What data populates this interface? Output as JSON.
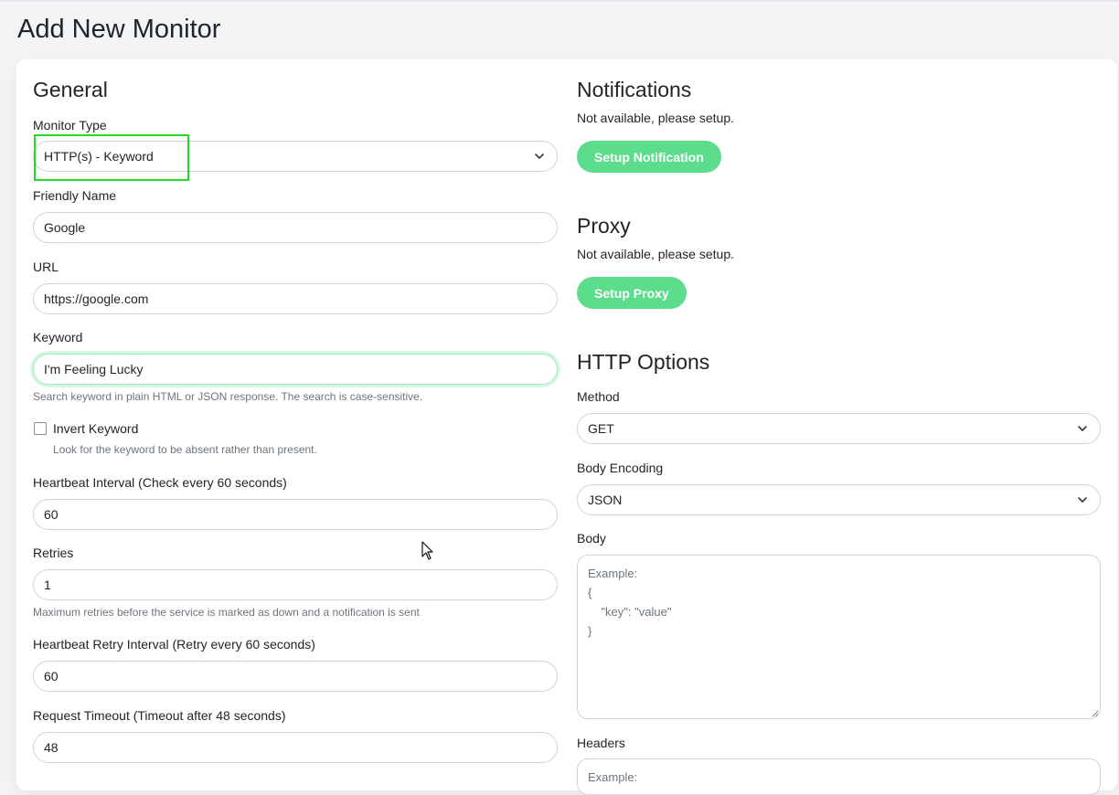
{
  "page": {
    "title": "Add New Monitor"
  },
  "general": {
    "heading": "General",
    "monitor_type": {
      "label": "Monitor Type",
      "value": "HTTP(s) - Keyword"
    },
    "friendly_name": {
      "label": "Friendly Name",
      "value": "Google"
    },
    "url": {
      "label": "URL",
      "value": "https://google.com"
    },
    "keyword": {
      "label": "Keyword",
      "value": "I'm Feeling Lucky",
      "help": "Search keyword in plain HTML or JSON response. The search is case-sensitive."
    },
    "invert_keyword": {
      "label": "Invert Keyword",
      "help": "Look for the keyword to be absent rather than present.",
      "checked": false
    },
    "heartbeat_interval": {
      "label": "Heartbeat Interval (Check every 60 seconds)",
      "value": "60"
    },
    "retries": {
      "label": "Retries",
      "value": "1",
      "help": "Maximum retries before the service is marked as down and a notification is sent"
    },
    "retry_interval": {
      "label": "Heartbeat Retry Interval (Retry every 60 seconds)",
      "value": "60"
    },
    "request_timeout": {
      "label": "Request Timeout (Timeout after 48 seconds)",
      "value": "48"
    }
  },
  "notifications": {
    "heading": "Notifications",
    "note": "Not available, please setup.",
    "button": "Setup Notification"
  },
  "proxy": {
    "heading": "Proxy",
    "note": "Not available, please setup.",
    "button": "Setup Proxy"
  },
  "http_options": {
    "heading": "HTTP Options",
    "method": {
      "label": "Method",
      "value": "GET"
    },
    "body_encoding": {
      "label": "Body Encoding",
      "value": "JSON"
    },
    "body": {
      "label": "Body",
      "placeholder": "Example:\n{\n    \"key\": \"value\"\n}"
    },
    "headers": {
      "label": "Headers",
      "placeholder": "Example:"
    }
  },
  "colors": {
    "accent": "#5cdd8b",
    "highlight": "#22dd22"
  }
}
